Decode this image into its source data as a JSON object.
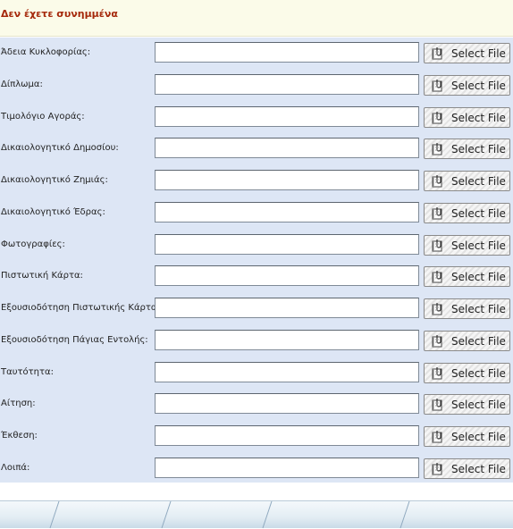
{
  "header": {
    "title": "Δεν έχετε συνημμένα"
  },
  "attachments": {
    "button_label": "Select File",
    "fields": [
      {
        "label": "Άδεια Κυκλοφορίας:",
        "value": ""
      },
      {
        "label": "Δίπλωμα:",
        "value": ""
      },
      {
        "label": "Τιμολόγιο Αγοράς:",
        "value": ""
      },
      {
        "label": "Δικαιολογητικό Δημοσίου:",
        "value": ""
      },
      {
        "label": "Δικαιολογητικό Ζημιάς:",
        "value": ""
      },
      {
        "label": "Δικαιολογητικό Έδρας:",
        "value": ""
      },
      {
        "label": "Φωτογραφίες:",
        "value": ""
      },
      {
        "label": "Πιστωτική Κάρτα:",
        "value": ""
      },
      {
        "label": "Εξουσιοδότηση Πιστωτικής Κάρτας:",
        "value": ""
      },
      {
        "label": "Εξουσιοδότηση Πάγιας Εντολής:",
        "value": ""
      },
      {
        "label": "Ταυτότητα:",
        "value": ""
      },
      {
        "label": "Αίτηση:",
        "value": ""
      },
      {
        "label": "Έκθεση:",
        "value": ""
      },
      {
        "label": "Λοιπά:",
        "value": ""
      }
    ]
  },
  "icons": {
    "button_icon": "file-attach-icon"
  },
  "colors": {
    "header_text": "#a5280b",
    "header_background": "#fbfbe9",
    "panel_background": "#dde6f5"
  }
}
